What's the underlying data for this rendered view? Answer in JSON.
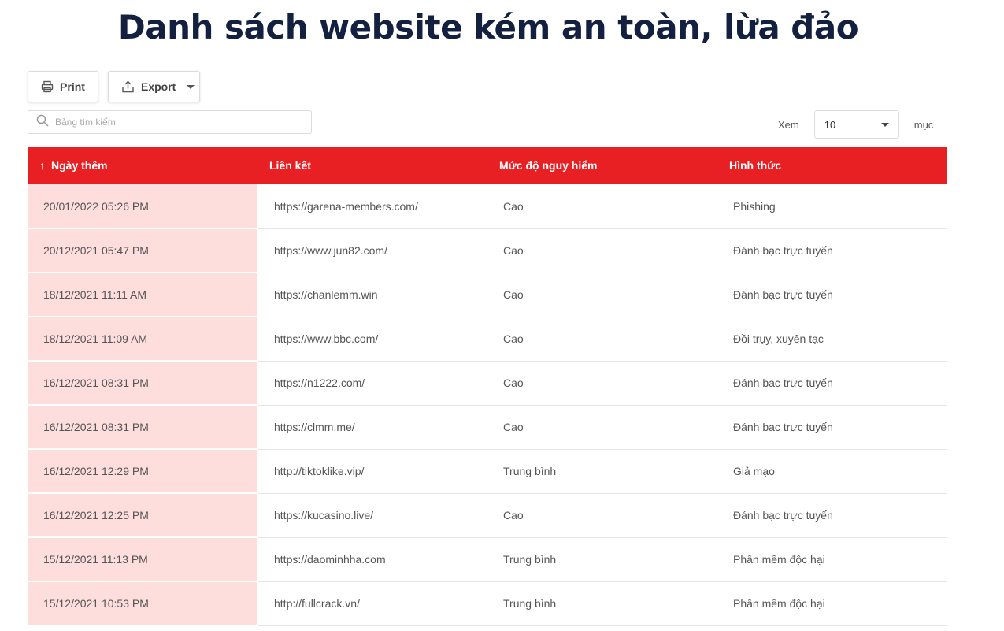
{
  "page": {
    "title": "Danh sách website kém an toàn, lừa đảo"
  },
  "toolbar": {
    "print_label": "Print",
    "export_label": "Export"
  },
  "search": {
    "placeholder": "Bảng tìm kiếm"
  },
  "page_size": {
    "label_before": "Xem",
    "value": "10",
    "label_after": "mục"
  },
  "table": {
    "sort_column": "date_added",
    "sort_direction": "ascending",
    "columns": [
      "Ngày thêm",
      "Liên kết",
      "Mức độ nguy hiểm",
      "Hình thức"
    ],
    "header_color": "#e82024",
    "highlight_color": "#fedddd",
    "rows": [
      {
        "date": "20/01/2022 05:26 PM",
        "link": "https://garena-members.com/",
        "level": "Cao",
        "type": "Phishing"
      },
      {
        "date": "20/12/2021 05:47 PM",
        "link": "https://www.jun82.com/",
        "level": "Cao",
        "type": "Đánh bạc trực tuyến"
      },
      {
        "date": "18/12/2021 11:11 AM",
        "link": "https://chanlemm.win",
        "level": "Cao",
        "type": "Đánh bạc trực tuyến"
      },
      {
        "date": "18/12/2021 11:09 AM",
        "link": "https://www.bbc.com/",
        "level": "Cao",
        "type": "Đồi trụy, xuyên tạc"
      },
      {
        "date": "16/12/2021 08:31 PM",
        "link": "https://n1222.com/",
        "level": "Cao",
        "type": "Đánh bạc trực tuyến"
      },
      {
        "date": "16/12/2021 08:31 PM",
        "link": "https://clmm.me/",
        "level": "Cao",
        "type": "Đánh bạc trực tuyến"
      },
      {
        "date": "16/12/2021 12:29 PM",
        "link": "http://tiktoklike.vip/",
        "level": "Trung bình",
        "type": "Giả mạo"
      },
      {
        "date": "16/12/2021 12:25 PM",
        "link": "https://kucasino.live/",
        "level": "Cao",
        "type": "Đánh bạc trực tuyến"
      },
      {
        "date": "15/12/2021 11:13 PM",
        "link": "https://daominhha.com",
        "level": "Trung bình",
        "type": "Phần mềm độc hại"
      },
      {
        "date": "15/12/2021 10:53 PM",
        "link": "http://fullcrack.vn/",
        "level": "Trung bình",
        "type": "Phần mềm độc hại"
      }
    ]
  }
}
